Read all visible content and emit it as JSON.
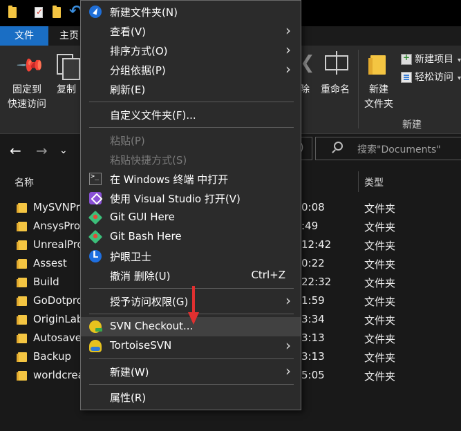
{
  "ribbon": {
    "tab_file": "文件",
    "tab_home": "主页",
    "pin_label_1": "固定到",
    "pin_label_2": "快速访问",
    "copy_label": "复制",
    "delete_label": "除",
    "rename_label": "重命名",
    "new_folder_1": "新建",
    "new_folder_2": "文件夹",
    "new_item": "新建项目",
    "easy_access": "轻松访问",
    "group_new": "新建"
  },
  "addressbar": {
    "search_placeholder": "搜索\"Documents\""
  },
  "filelist": {
    "col_name": "名称",
    "col_type": "类型",
    "rows": [
      {
        "name": "MySVNPr",
        "time": "0:08",
        "type": "文件夹"
      },
      {
        "name": "AnsysProj",
        "time": ":49",
        "type": "文件夹"
      },
      {
        "name": "UnrealPro",
        "time": "12:42",
        "type": "文件夹"
      },
      {
        "name": "Assest",
        "time": "0:22",
        "type": "文件夹"
      },
      {
        "name": "Build",
        "time": "22:32",
        "type": "文件夹"
      },
      {
        "name": "GoDotpro",
        "time": "1:59",
        "type": "文件夹"
      },
      {
        "name": "OriginLab",
        "time": "3:34",
        "type": "文件夹"
      },
      {
        "name": "Autosave",
        "time": "3:13",
        "type": "文件夹"
      },
      {
        "name": "Backup",
        "time": "3:13",
        "type": "文件夹"
      },
      {
        "name": "worldcrea",
        "time": "5:05",
        "type": "文件夹"
      }
    ]
  },
  "context_menu": {
    "new_folder": "新建文件夹(N)",
    "view": "查看(V)",
    "sort_by": "排序方式(O)",
    "group_by": "分组依据(P)",
    "refresh": "刷新(E)",
    "customize": "自定义文件夹(F)...",
    "paste": "粘贴(P)",
    "paste_shortcut": "粘贴快捷方式(S)",
    "open_terminal": "在 Windows 终端 中打开",
    "open_vs": "使用 Visual Studio 打开(V)",
    "git_gui": "Git GUI Here",
    "git_bash": "Git Bash Here",
    "eye_guard": "护眼卫士",
    "undo_delete": "撤消 删除(U)",
    "undo_shortcut": "Ctrl+Z",
    "grant_access": "授予访问权限(G)",
    "svn_checkout": "SVN Checkout...",
    "tortoise_svn": "TortoiseSVN",
    "new": "新建(W)",
    "properties": "属性(R)"
  },
  "colors": {
    "accent": "#1a6ec4",
    "menu_bg": "#2b2b2b",
    "highlight": "#414141",
    "folder": "#f4c542",
    "annotation_arrow": "#e03030"
  }
}
